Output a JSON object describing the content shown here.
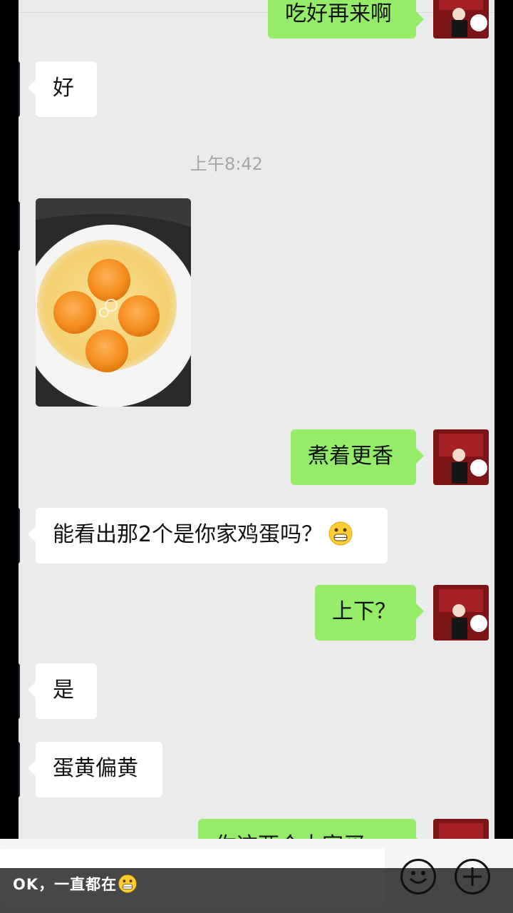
{
  "messages": {
    "m0": "吃好再来啊",
    "m1": "好",
    "time": "上午8:42",
    "m3": "煮着更香",
    "m4": "能看出那2个是你家鸡蛋吗？",
    "m5": "上下？",
    "m6": "是",
    "m7": "蛋黄偏黄",
    "m8": "你这两个大家买"
  },
  "caption": "OK，一直都在",
  "icons": {
    "emoji_in_message": "grinning-face-icon",
    "caption_emoji": "grinning-face-icon",
    "emoji_button": "smiley-icon",
    "more_button": "plus-circle-icon"
  },
  "colors": {
    "chat_background": "#ebebeb",
    "outgoing_bubble": "#95ec69",
    "incoming_bubble": "#ffffff"
  }
}
